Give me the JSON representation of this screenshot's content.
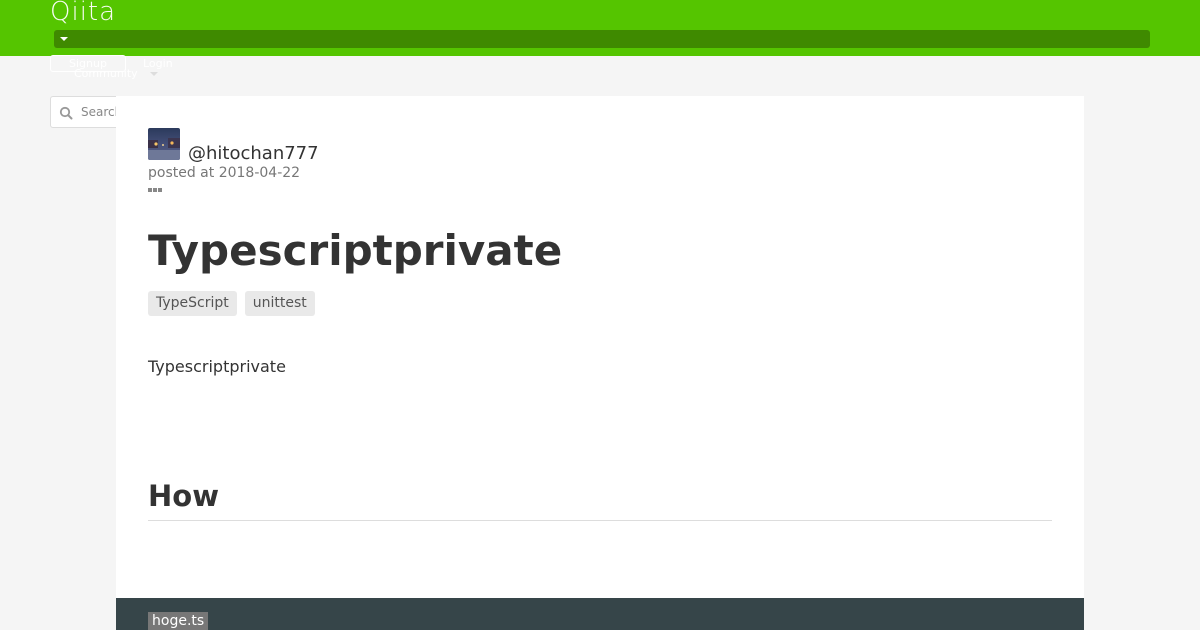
{
  "header": {
    "logo": "Qiita",
    "signup_label": "Signup",
    "login_label": "Login",
    "community_label": "Community",
    "brand_color": "#55c500"
  },
  "search": {
    "placeholder": "Search",
    "value": ""
  },
  "article": {
    "author": "@hitochan777",
    "posted_at": "posted at 2018-04-22",
    "title": "Typescriptprivate",
    "tags": [
      "TypeScript",
      "unittest"
    ],
    "intro": "Typescriptprivate",
    "section_heading": "How",
    "code_filename": "hoge.ts"
  },
  "icons": {
    "search": "search-icon",
    "more": "more-icon",
    "dropdown": "chevron-down-icon"
  }
}
